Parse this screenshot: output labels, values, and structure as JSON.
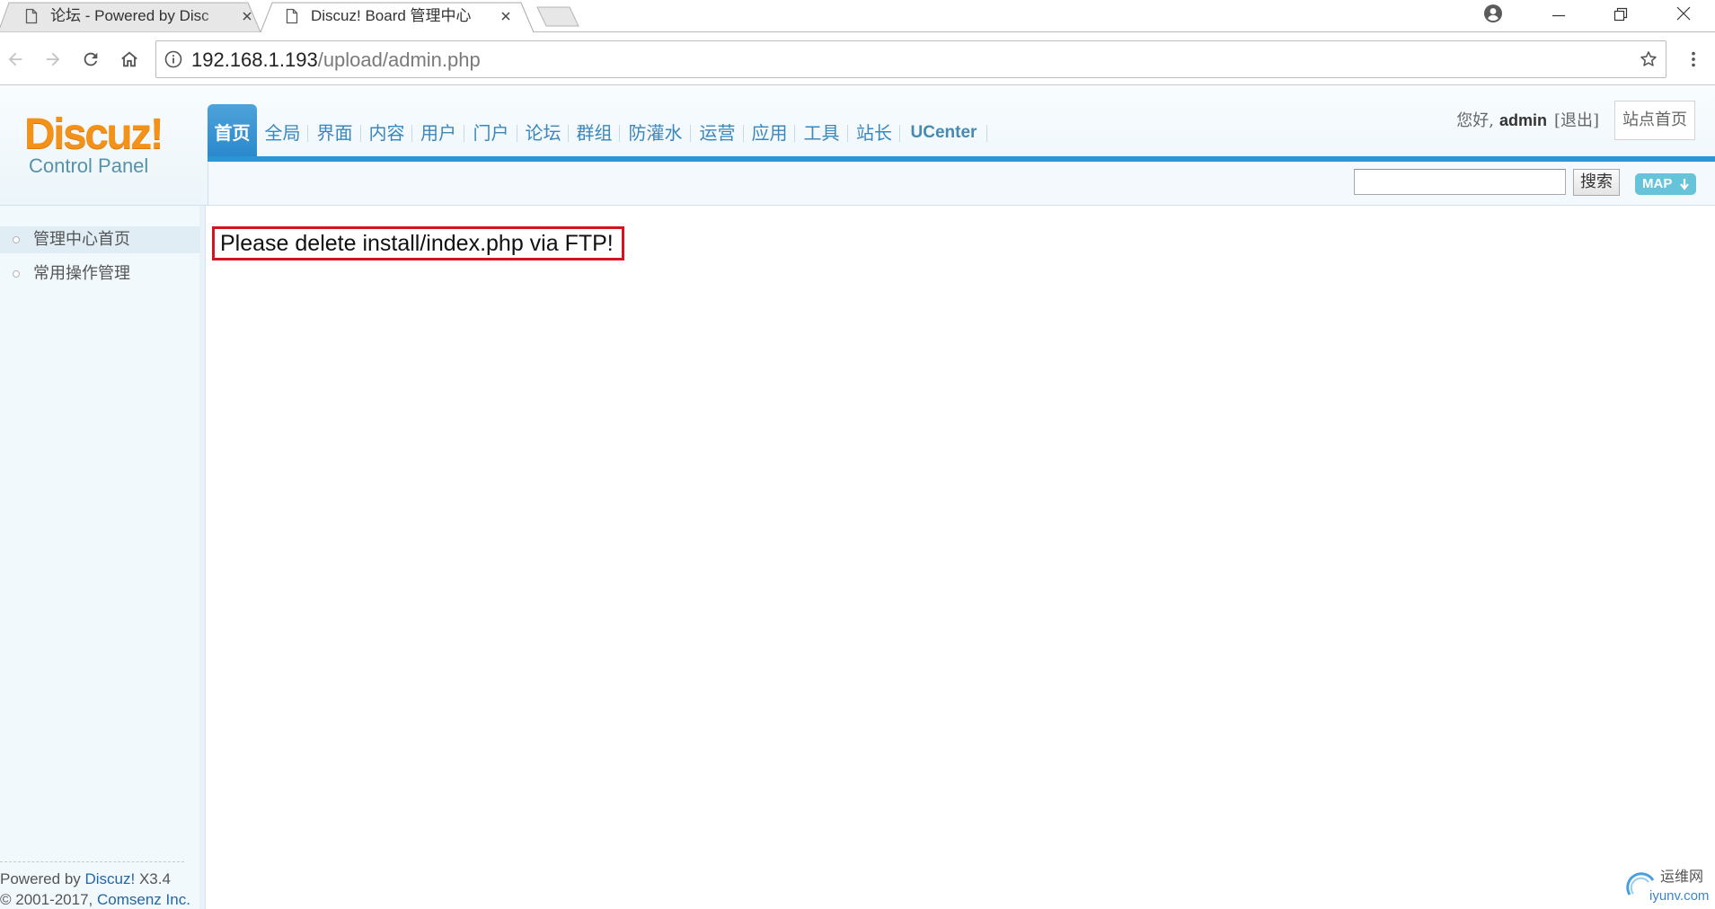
{
  "browser": {
    "tabs": [
      {
        "title": "论坛 - Powered by Disc",
        "icon": "document-icon",
        "active": false
      },
      {
        "title": "Discuz! Board 管理中心",
        "icon": "document-icon",
        "active": true
      }
    ],
    "address": {
      "host": "192.168.1.193",
      "path": "/upload/admin.php"
    },
    "icons": [
      "profile-icon",
      "minimize-icon",
      "restore-icon",
      "close-icon",
      "back-arrow-icon",
      "forward-arrow-icon",
      "reload-icon",
      "home-icon",
      "info-icon",
      "star-icon",
      "menu-icon",
      "new-tab-icon"
    ]
  },
  "header": {
    "logo": {
      "brand": "Discuz!",
      "subtitle": "Control Panel"
    },
    "nav": [
      {
        "label": "首页",
        "active": true
      },
      {
        "label": "全局"
      },
      {
        "label": "界面"
      },
      {
        "label": "内容"
      },
      {
        "label": "用户"
      },
      {
        "label": "门户"
      },
      {
        "label": "论坛"
      },
      {
        "label": "群组"
      },
      {
        "label": "防灌水"
      },
      {
        "label": "运营"
      },
      {
        "label": "应用"
      },
      {
        "label": "工具"
      },
      {
        "label": "站长"
      },
      {
        "label": "UCenter"
      }
    ],
    "user": {
      "greeting": "您好,",
      "name": "admin",
      "logout": "[退出]"
    },
    "site_home": "站点首页",
    "search": {
      "value": "",
      "button": "搜索"
    },
    "map_button": "MAP",
    "map_icon": "down-arrow-icon"
  },
  "sidebar": {
    "items": [
      {
        "label": "管理中心首页",
        "active": true
      },
      {
        "label": "常用操作管理",
        "active": false
      }
    ],
    "footer": {
      "powered_prefix": "Powered by ",
      "powered_link": "Discuz!",
      "version": " X3.4",
      "copyright_prefix": "© 2001-2017, ",
      "company_link": "Comsenz Inc."
    }
  },
  "main": {
    "notice": "Please delete install/index.php via FTP!"
  },
  "watermark": {
    "name": "运维网",
    "site": "iyunv.com"
  },
  "colors": {
    "brand_orange": "#f39219",
    "nav_active": "#2b96d6",
    "nav_text": "#3a87bd",
    "link": "#2366a8",
    "notice_border": "#d3131f",
    "sidebar_bg": "#f2f9fd",
    "map_button": "#67c3da"
  }
}
